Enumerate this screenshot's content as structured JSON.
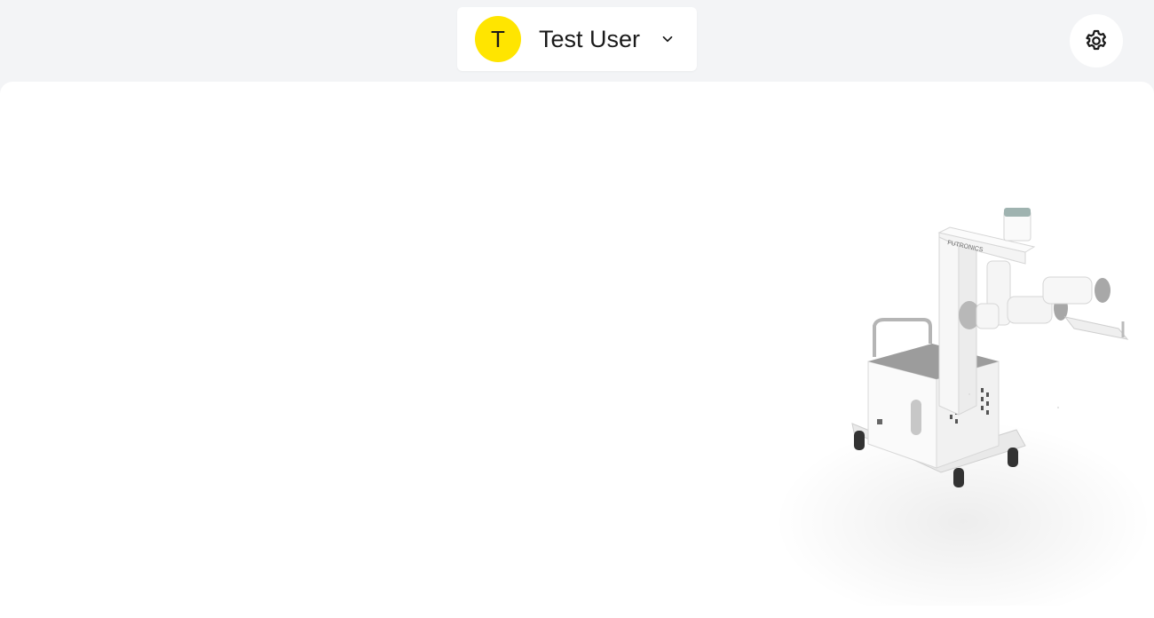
{
  "user_menu": {
    "avatar_initial": "T",
    "user_name": "Test User",
    "avatar_color": "#ffe500"
  },
  "icons": {
    "dropdown": "chevron-down-icon",
    "settings": "gear-icon"
  },
  "robot_image": {
    "brand_text": "FUTRONICS"
  }
}
